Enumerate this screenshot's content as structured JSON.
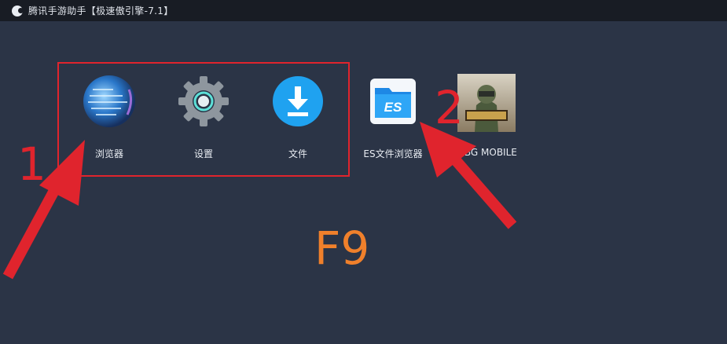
{
  "window": {
    "title": "腾讯手游助手【极速傲引擎-7.1】",
    "logo_icon": "tencent-logo-icon"
  },
  "apps": [
    {
      "label": "浏览器",
      "icon": "globe-browser-icon"
    },
    {
      "label": "设置",
      "icon": "gear-settings-icon"
    },
    {
      "label": "文件",
      "icon": "download-file-icon"
    },
    {
      "label": "ES文件浏览器",
      "icon": "es-file-explorer-icon"
    },
    {
      "label": "UBG MOBILE",
      "icon": "pubg-mobile-icon"
    }
  ],
  "annotations": {
    "callout_1": "1",
    "callout_2": "2",
    "hotkey": "F9",
    "color": "#e0242d",
    "hotkey_color": "#f0802b"
  }
}
